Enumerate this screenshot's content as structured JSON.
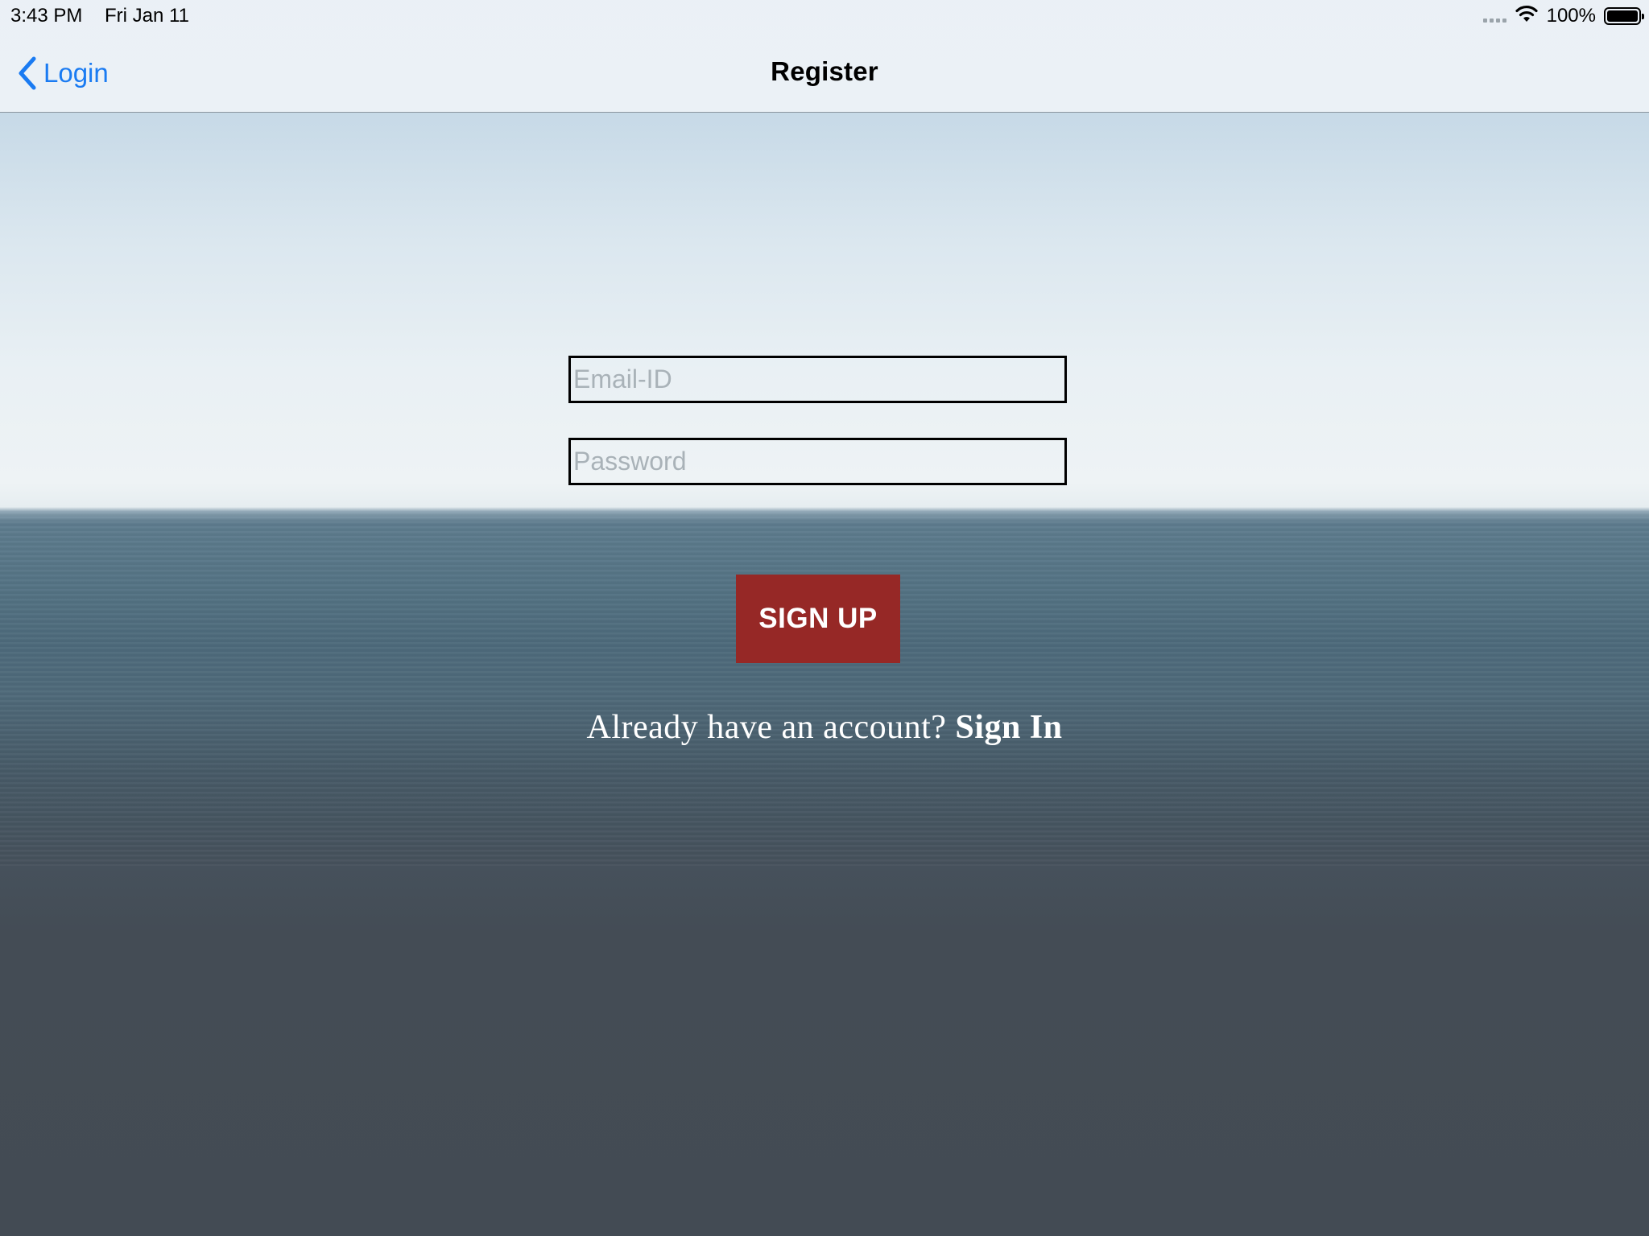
{
  "status_bar": {
    "time": "3:43 PM",
    "date": "Fri Jan 11",
    "battery": "100%",
    "icons": [
      "cellular-signal-icon",
      "wifi-icon",
      "battery-icon"
    ]
  },
  "nav": {
    "back_label": "Login",
    "title": "Register",
    "back_icon": "chevron-left-icon"
  },
  "form": {
    "email": {
      "placeholder": "Email-ID",
      "value": ""
    },
    "password": {
      "placeholder": "Password",
      "value": ""
    },
    "signup_label": "SIGN UP"
  },
  "footer": {
    "prompt": "Already have an account?",
    "link": "Sign In"
  },
  "colors": {
    "accent_blue": "#1a7bf2",
    "signup_button": "#962826",
    "text_white": "#ffffff"
  }
}
